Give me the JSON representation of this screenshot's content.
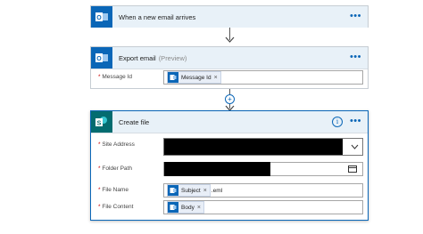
{
  "trigger": {
    "title": "When a new email arrives"
  },
  "export": {
    "title": "Export email",
    "preview": "(Preview)",
    "message_label": "Message Id",
    "message_token": "Message Id"
  },
  "create": {
    "title": "Create file",
    "info": "i",
    "site_label": "Site Address",
    "folder_label": "Folder Path",
    "filename_label": "File Name",
    "filename_token": "Subject",
    "filename_suffix": ".eml",
    "content_label": "File Content",
    "content_token": "Body"
  },
  "common": {
    "required_star": "*",
    "remove_x": "×",
    "more": "•••",
    "add": "+"
  },
  "colors": {
    "outlook": "#0a66b7",
    "sharepoint": "#036c70",
    "header": "#e8f1f8"
  }
}
